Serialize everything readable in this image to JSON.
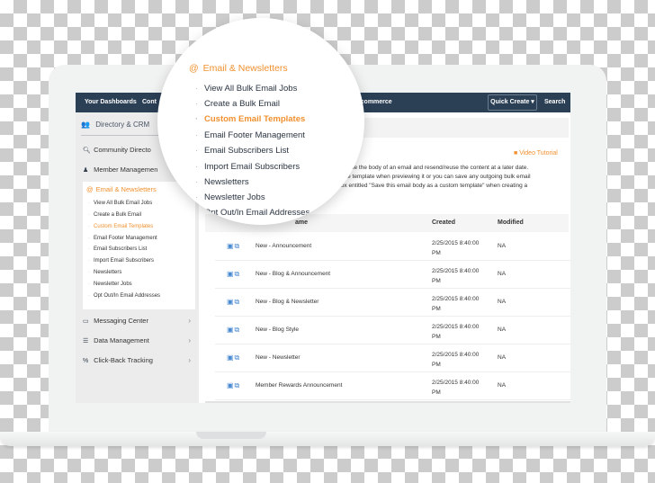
{
  "topnav": {
    "items": [
      "Your Dashboards",
      "Cont",
      "Ecommerce"
    ],
    "quick_create": "Quick Create ▾",
    "search": "Search"
  },
  "sidebar": {
    "header": "Directory & CRM",
    "items": [
      {
        "label": "Community Directo",
        "icon": "search-icon"
      },
      {
        "label": "Member Managemen",
        "icon": "user-icon"
      }
    ],
    "email_section": {
      "title": "Email & Newsletters",
      "links": [
        "View All Bulk Email Jobs",
        "Create a Bulk Email",
        "Custom Email Templates",
        "Email Footer Management",
        "Email Subscribers List",
        "Import Email Subscribers",
        "Newsletters",
        "Newsletter Jobs",
        "Opt Out/In Email Addresses"
      ],
      "active_index": 2
    },
    "bottom_items": [
      {
        "label": "Messaging Center",
        "icon": "inbox-icon"
      },
      {
        "label": "Data Management",
        "icon": "list-icon"
      },
      {
        "label": "Click-Back Tracking",
        "icon": "link-icon"
      }
    ]
  },
  "main": {
    "video_tutorial": "Video Tutorial",
    "description": [
      "ompose the body of an email and resend/reuse the content at a later date.",
      "py the template when previewing it or you can save any outgoing bulk email",
      "kbox entitled \"Save this email body as a custom template\" when creating a"
    ],
    "table": {
      "headers": [
        "ame",
        "Created",
        "Modified"
      ],
      "rows": [
        {
          "name": "New - Announcement",
          "created": "2/25/2015 8:40:00 PM",
          "modified": "NA"
        },
        {
          "name": "New - Blog & Announcement",
          "created": "2/25/2015 8:40:00 PM",
          "modified": "NA"
        },
        {
          "name": "New - Blog & Newsletter",
          "created": "2/25/2015 8:40:00 PM",
          "modified": "NA"
        },
        {
          "name": "New - Blog Style",
          "created": "2/25/2015 8:40:00 PM",
          "modified": "NA"
        },
        {
          "name": "New - Newsletter",
          "created": "2/25/2015 8:40:00 PM",
          "modified": "NA"
        },
        {
          "name": "Member Rewards Announcement",
          "created": "2/25/2015 8:40:00 PM",
          "modified": "NA"
        }
      ]
    }
  },
  "colors": {
    "accent": "#f0902f",
    "nav": "#2b3f55",
    "link_icon": "#4a8ad1"
  }
}
